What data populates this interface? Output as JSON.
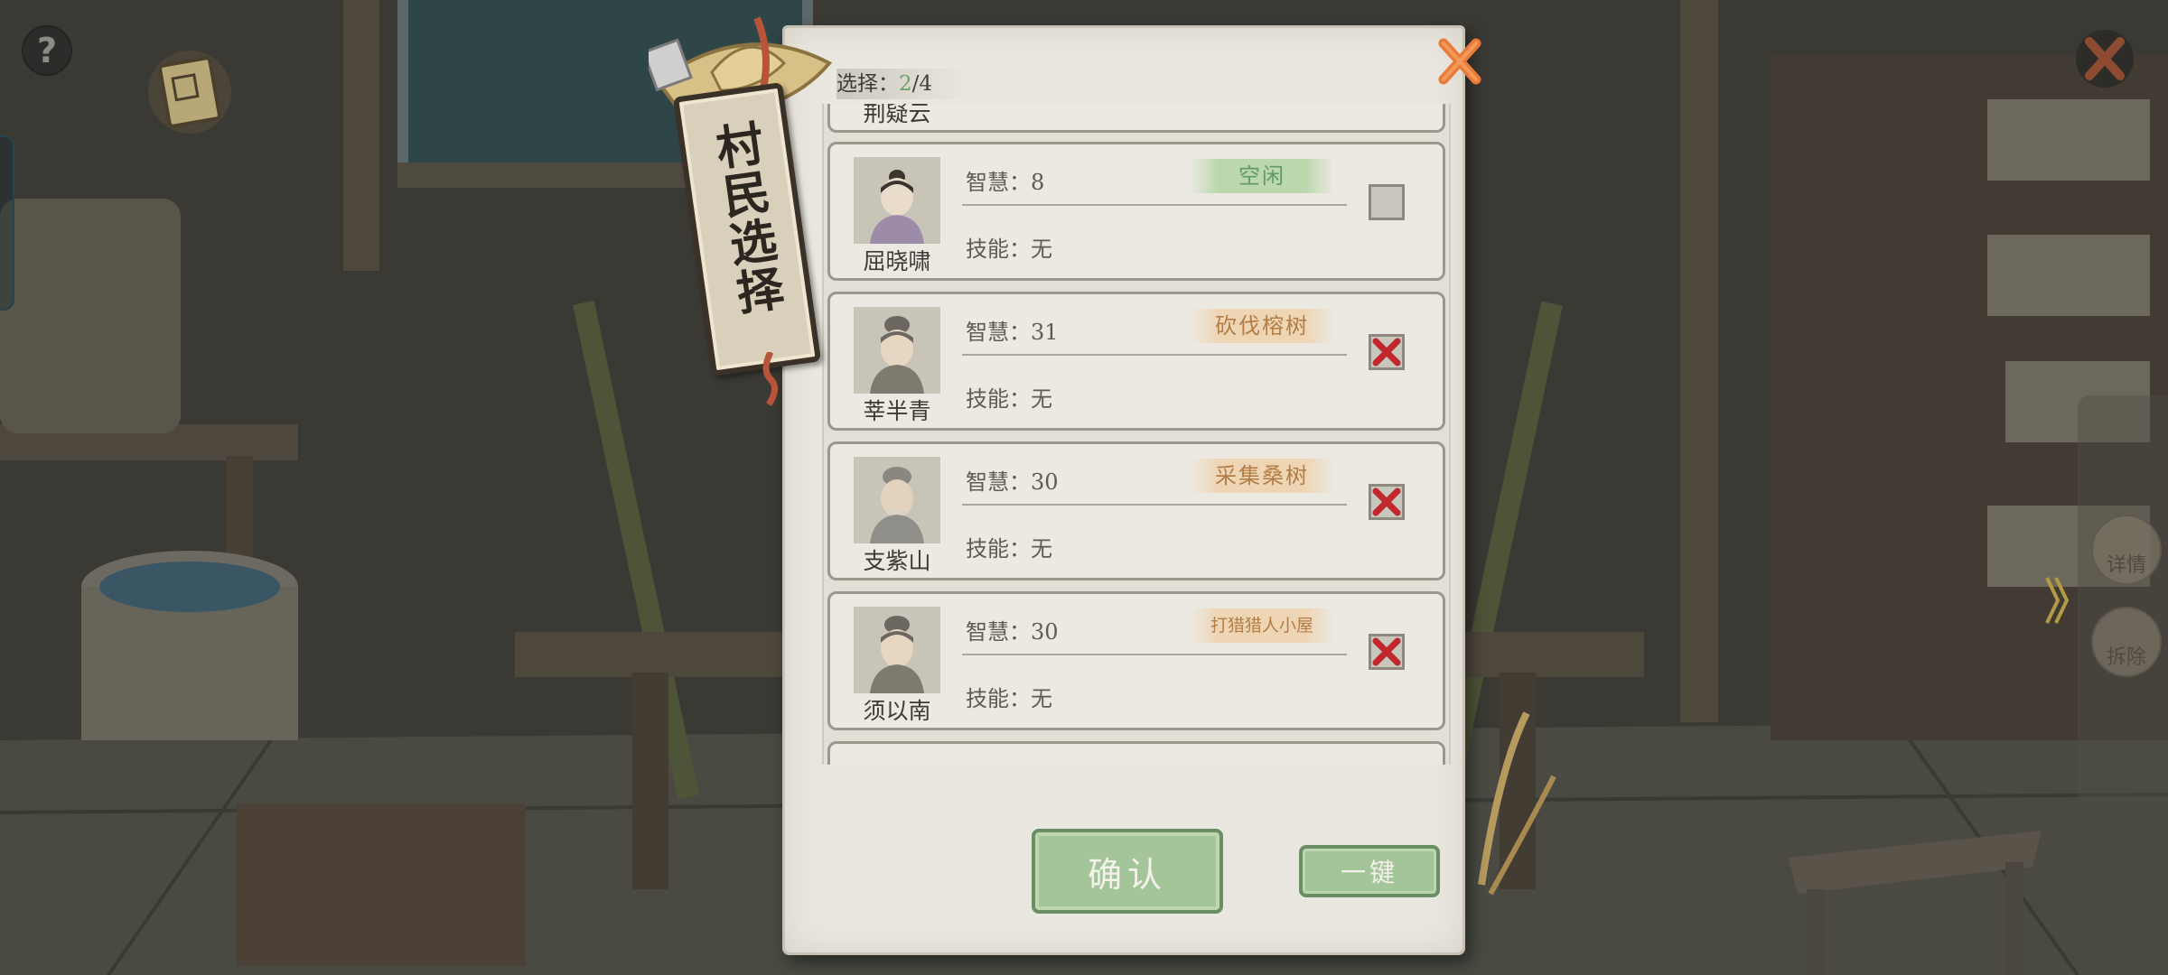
{
  "hud": {
    "help_symbol": "?",
    "icons": {
      "help": "question-icon",
      "book": "ledger-book-icon",
      "close": "close-x-icon"
    }
  },
  "side_panel": {
    "detail_label": "详情",
    "demolish_label": "拆除"
  },
  "dialog": {
    "title": "村民选择",
    "selection_prefix": "选择：",
    "selected": "2",
    "separator": "/",
    "capacity": "4",
    "partial_top_name": "荆疑云",
    "villagers": [
      {
        "name": "屈晓啸",
        "wisdom": "智慧：8",
        "skill": "技能：无",
        "status": "空闲",
        "status_type": "idle",
        "checked": false
      },
      {
        "name": "莘半青",
        "wisdom": "智慧：31",
        "skill": "技能：无",
        "status": "砍伐榕树",
        "status_type": "busy",
        "checked": true
      },
      {
        "name": "支紫山",
        "wisdom": "智慧：30",
        "skill": "技能：无",
        "status": "采集桑树",
        "status_type": "busy",
        "checked": true
      },
      {
        "name": "须以南",
        "wisdom": "智慧：30",
        "skill": "技能：无",
        "status": "打猎猎人小屋",
        "status_type": "busy",
        "checked": true
      }
    ],
    "confirm_label": "确认",
    "one_key_label": "一键"
  },
  "colors": {
    "idle_green": "#5f9b63",
    "busy_orange": "#b47d45",
    "check_red": "#c0282c",
    "button_green": "#a4c59a",
    "close_orange": "#e87b3a"
  }
}
